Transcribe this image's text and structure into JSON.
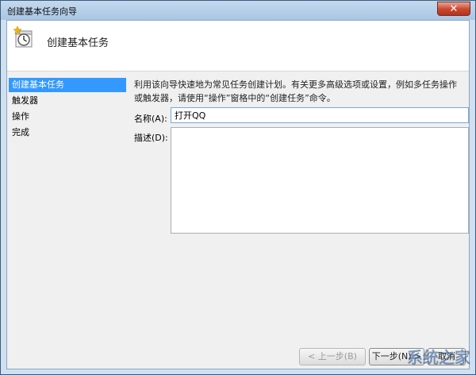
{
  "window": {
    "title": "创建基本任务向导",
    "close_label": "✕",
    "accent_color": "#3399ff"
  },
  "header": {
    "title": "创建基本任务",
    "icon": "task-scheduler-clock-icon"
  },
  "nav": {
    "items": [
      {
        "label": "创建基本任务",
        "selected": true
      },
      {
        "label": "触发器",
        "selected": false
      },
      {
        "label": "操作",
        "selected": false
      },
      {
        "label": "完成",
        "selected": false
      }
    ]
  },
  "content": {
    "description": "利用该向导快速地为常见任务创建计划。有关更多高级选项或设置，例如多任务操作或触发器，请使用“操作”窗格中的“创建任务”命令。",
    "name_label": "名称(A):",
    "name_value": "打开QQ",
    "desc_label": "描述(D):",
    "desc_value": ""
  },
  "buttons": {
    "back": "< 上一步(B)",
    "next": "下一步(N) >",
    "cancel": "取消"
  },
  "watermark": {
    "text": "系统之家"
  }
}
